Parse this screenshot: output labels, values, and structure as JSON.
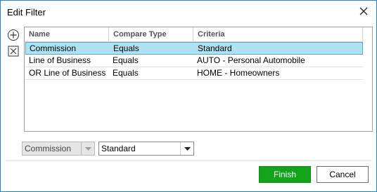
{
  "window": {
    "title": "Edit Filter"
  },
  "icons": {
    "close": "close-icon",
    "add": "plus-circle-icon",
    "remove": "x-box-icon",
    "dropdown": "chevron-down-icon"
  },
  "grid": {
    "columns": [
      "Name",
      "Compare Type",
      "Criteria"
    ],
    "rows": [
      {
        "name": "Commission",
        "compare": "Equals",
        "criteria": "Standard",
        "selected": true
      },
      {
        "name": "Line of Business",
        "compare": "Equals",
        "criteria": "AUTO - Personal Automobile",
        "selected": false
      },
      {
        "name": "OR Line of Business",
        "compare": "Equals",
        "criteria": "HOME - Homeowners",
        "selected": false
      }
    ]
  },
  "editor": {
    "field_value": "Commission",
    "criteria_value": "Standard"
  },
  "buttons": {
    "finish": "Finish",
    "cancel": "Cancel"
  },
  "colors": {
    "selected_row": "#aee2f2",
    "finish_button": "#12a31a",
    "window_border": "#1883d7"
  }
}
